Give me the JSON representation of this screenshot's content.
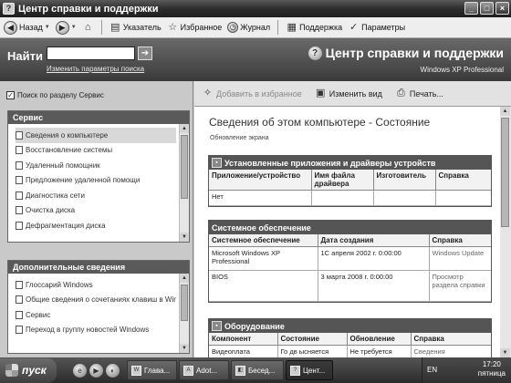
{
  "window": {
    "title": "Центр справки и поддержки"
  },
  "navbar": {
    "back": "Назад",
    "index": "Указатель",
    "favorites": "Избранное",
    "history": "Журнал",
    "support": "Поддержка",
    "options": "Параметры"
  },
  "header": {
    "find_label": "Найти",
    "search_value": "",
    "search_options": "Изменить параметры поиска",
    "brand": "Центр справки и поддержки",
    "brand_sub": "Windows XP Professional"
  },
  "left": {
    "search_within": "Поиск по разделу Сервис",
    "service": {
      "title": "Сервис",
      "items": [
        "Сведения о компьютере",
        "Восстановление системы",
        "Удаленный помощник",
        "Предложение удаленной помощи",
        "Диагностика сети",
        "Очистка диска",
        "Дефрагментация диска"
      ]
    },
    "additional": {
      "title": "Дополнительные сведения",
      "items": [
        "Глоссарий Windows",
        "Общие сведения о сочетаниях клавиш в Wind",
        "Сервис",
        "Переход в группу новостей Windows"
      ]
    }
  },
  "content_toolbar": {
    "add_favorites": "Добавить в избранное",
    "change_view": "Изменить вид",
    "print": "Печать..."
  },
  "content": {
    "title": "Сведения об этом компьютере - Состояние",
    "refresh": "Обновление экрана",
    "apps": {
      "title": "Установленные приложения и драйверы устройств",
      "columns": [
        "Приложение/устройство",
        "Имя файла драйвера",
        "Изготовитель",
        "Справка"
      ],
      "rows": [
        [
          "Нет",
          "",
          "",
          ""
        ]
      ]
    },
    "software": {
      "title": "Системное обеспечение",
      "columns": [
        "Системное обеспечение",
        "Дата создания",
        "Справка"
      ],
      "rows": [
        [
          "Microsoft Windows XP Professional",
          "1С апреля 2002 г. 0:00:00",
          "Windows Update"
        ],
        [
          "BIOS",
          "3 марта 2008 г. 0:00:00",
          "Просмотр раздела справки"
        ]
      ]
    },
    "hardware": {
      "title": "Оборудование",
      "columns": [
        "Компонент",
        "Состояние",
        "Обновление",
        "Справка"
      ],
      "rows": [
        [
          "Видеоплата",
          "Го дв ысняется",
          "Не требуется",
          "Сведения"
        ]
      ]
    }
  },
  "taskbar": {
    "start": "пуск",
    "tasks": [
      "Глава...",
      "Adot...",
      "Бесед...",
      "Цент..."
    ],
    "lang": "EN",
    "clock_time": "17:20",
    "clock_day": "пятница"
  }
}
